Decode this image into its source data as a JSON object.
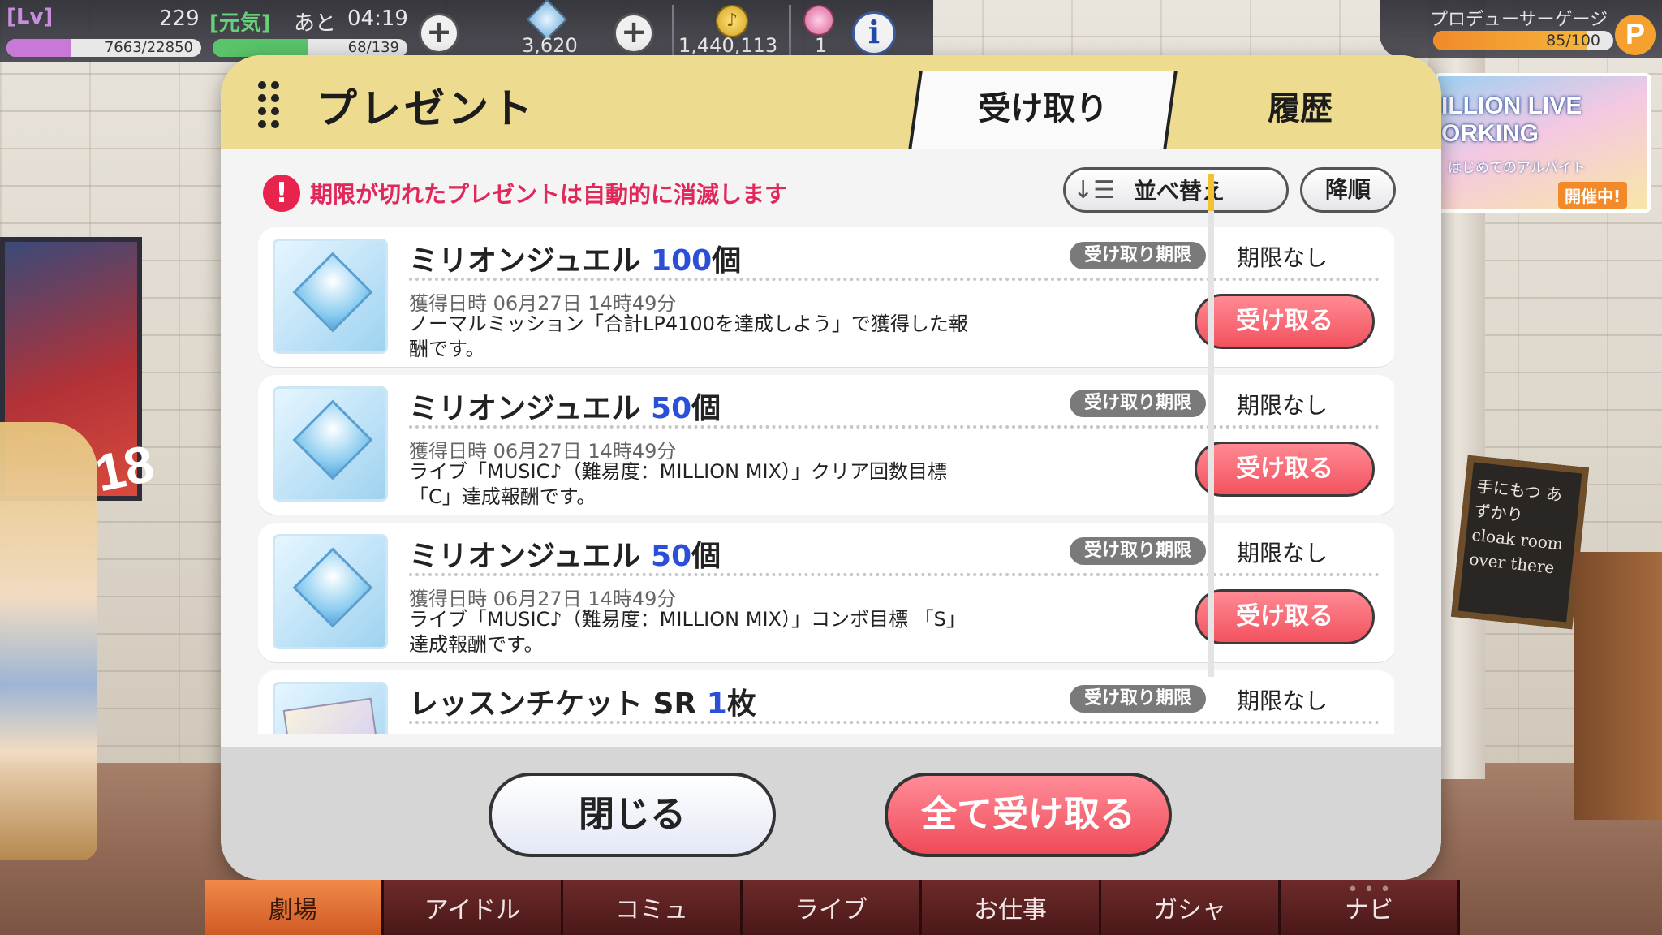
{
  "status": {
    "lv_tag": "[Lv]",
    "level": "229",
    "stamina_label": "[元気]",
    "time_prefix": "あと",
    "time_value": "04:19",
    "exp_text": "7663/22850",
    "exp_ratio": 0.335,
    "stamina_text": "68/139",
    "stamina_ratio": 0.489,
    "jewels": "3,620",
    "money": "1,440,113",
    "tickets": "1",
    "info_label": "i",
    "plus_label": "+",
    "money_symbol": "♪"
  },
  "gauge": {
    "label": "プロデューサーゲージ",
    "value_text": "85/100",
    "ratio": 0.85,
    "badge": "P"
  },
  "banner": {
    "title": "ILLION LIVE ORKING",
    "subtitle": "はじめてのアルバイト",
    "tag": "開催中!"
  },
  "background": {
    "poster_number": "18",
    "board_text": "手にもつ あずかり cloak room over there"
  },
  "modal": {
    "title": "プレゼント",
    "tabs": [
      {
        "label": "受け取り",
        "active": true
      },
      {
        "label": "履歴",
        "active": false
      }
    ],
    "notice": "期限が切れたプレゼントは自動的に消滅します",
    "warn_glyph": "!",
    "sort_icon": "↓☰",
    "sort_label": "並べ替え",
    "order_label": "降順",
    "items": [
      {
        "name": "ミリオンジュエル",
        "qty": "100",
        "unit": "個",
        "limit_tag": "受け取り期限",
        "limit_value": "期限なし",
        "date": "獲得日時 06月27日 14時49分",
        "desc": "ノーマルミッション「合計LP4100を達成しよう」で獲得した報酬です。",
        "button": "受け取る",
        "icon": "jewel-icon"
      },
      {
        "name": "ミリオンジュエル",
        "qty": "50",
        "unit": "個",
        "limit_tag": "受け取り期限",
        "limit_value": "期限なし",
        "date": "獲得日時 06月27日 14時49分",
        "desc": "ライブ「MUSIC♪（難易度：MILLION MIX）」クリア回数目標 「C」達成報酬です。",
        "button": "受け取る",
        "icon": "jewel-icon"
      },
      {
        "name": "ミリオンジュエル",
        "qty": "50",
        "unit": "個",
        "limit_tag": "受け取り期限",
        "limit_value": "期限なし",
        "date": "獲得日時 06月27日 14時49分",
        "desc": "ライブ「MUSIC♪（難易度：MILLION MIX）」コンボ目標 「S」達成報酬です。",
        "button": "受け取る",
        "icon": "jewel-icon"
      },
      {
        "name": "レッスンチケット SR",
        "qty": "1",
        "unit": "枚",
        "limit_tag": "受け取り期限",
        "limit_value": "期限なし",
        "date": "",
        "desc": "",
        "button": "",
        "icon": "lesson-ticket-icon"
      }
    ],
    "close_label": "閉じる",
    "receive_all_label": "全て受け取る"
  },
  "nav": [
    {
      "label": "劇場",
      "active": true
    },
    {
      "label": "アイドル",
      "active": false
    },
    {
      "label": "コミュ",
      "active": false
    },
    {
      "label": "ライブ",
      "active": false
    },
    {
      "label": "お仕事",
      "active": false
    },
    {
      "label": "ガシャ",
      "active": false
    },
    {
      "label": "ナビ",
      "active": false
    }
  ],
  "colors": {
    "accent_pink": "#f2525e",
    "quantity_blue": "#2c4fd8",
    "warning_red": "#e8244e",
    "header_gold": "#eddc8f",
    "nav_active": "#e0703a"
  }
}
